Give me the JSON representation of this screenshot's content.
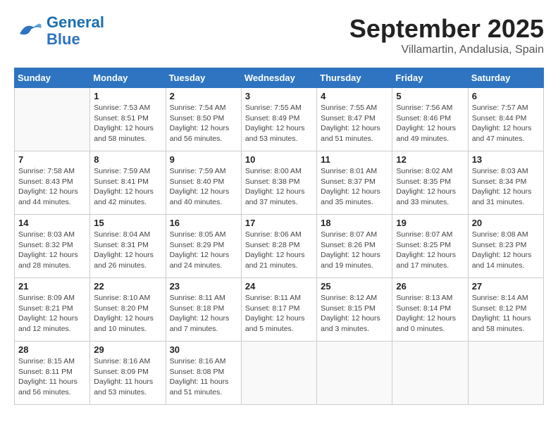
{
  "header": {
    "logo_line1": "General",
    "logo_line2": "Blue",
    "month": "September 2025",
    "location": "Villamartin, Andalusia, Spain"
  },
  "weekdays": [
    "Sunday",
    "Monday",
    "Tuesday",
    "Wednesday",
    "Thursday",
    "Friday",
    "Saturday"
  ],
  "weeks": [
    [
      {
        "day": "",
        "info": ""
      },
      {
        "day": "1",
        "info": "Sunrise: 7:53 AM\nSunset: 8:51 PM\nDaylight: 12 hours\nand 58 minutes."
      },
      {
        "day": "2",
        "info": "Sunrise: 7:54 AM\nSunset: 8:50 PM\nDaylight: 12 hours\nand 56 minutes."
      },
      {
        "day": "3",
        "info": "Sunrise: 7:55 AM\nSunset: 8:49 PM\nDaylight: 12 hours\nand 53 minutes."
      },
      {
        "day": "4",
        "info": "Sunrise: 7:55 AM\nSunset: 8:47 PM\nDaylight: 12 hours\nand 51 minutes."
      },
      {
        "day": "5",
        "info": "Sunrise: 7:56 AM\nSunset: 8:46 PM\nDaylight: 12 hours\nand 49 minutes."
      },
      {
        "day": "6",
        "info": "Sunrise: 7:57 AM\nSunset: 8:44 PM\nDaylight: 12 hours\nand 47 minutes."
      }
    ],
    [
      {
        "day": "7",
        "info": "Sunrise: 7:58 AM\nSunset: 8:43 PM\nDaylight: 12 hours\nand 44 minutes."
      },
      {
        "day": "8",
        "info": "Sunrise: 7:59 AM\nSunset: 8:41 PM\nDaylight: 12 hours\nand 42 minutes."
      },
      {
        "day": "9",
        "info": "Sunrise: 7:59 AM\nSunset: 8:40 PM\nDaylight: 12 hours\nand 40 minutes."
      },
      {
        "day": "10",
        "info": "Sunrise: 8:00 AM\nSunset: 8:38 PM\nDaylight: 12 hours\nand 37 minutes."
      },
      {
        "day": "11",
        "info": "Sunrise: 8:01 AM\nSunset: 8:37 PM\nDaylight: 12 hours\nand 35 minutes."
      },
      {
        "day": "12",
        "info": "Sunrise: 8:02 AM\nSunset: 8:35 PM\nDaylight: 12 hours\nand 33 minutes."
      },
      {
        "day": "13",
        "info": "Sunrise: 8:03 AM\nSunset: 8:34 PM\nDaylight: 12 hours\nand 31 minutes."
      }
    ],
    [
      {
        "day": "14",
        "info": "Sunrise: 8:03 AM\nSunset: 8:32 PM\nDaylight: 12 hours\nand 28 minutes."
      },
      {
        "day": "15",
        "info": "Sunrise: 8:04 AM\nSunset: 8:31 PM\nDaylight: 12 hours\nand 26 minutes."
      },
      {
        "day": "16",
        "info": "Sunrise: 8:05 AM\nSunset: 8:29 PM\nDaylight: 12 hours\nand 24 minutes."
      },
      {
        "day": "17",
        "info": "Sunrise: 8:06 AM\nSunset: 8:28 PM\nDaylight: 12 hours\nand 21 minutes."
      },
      {
        "day": "18",
        "info": "Sunrise: 8:07 AM\nSunset: 8:26 PM\nDaylight: 12 hours\nand 19 minutes."
      },
      {
        "day": "19",
        "info": "Sunrise: 8:07 AM\nSunset: 8:25 PM\nDaylight: 12 hours\nand 17 minutes."
      },
      {
        "day": "20",
        "info": "Sunrise: 8:08 AM\nSunset: 8:23 PM\nDaylight: 12 hours\nand 14 minutes."
      }
    ],
    [
      {
        "day": "21",
        "info": "Sunrise: 8:09 AM\nSunset: 8:21 PM\nDaylight: 12 hours\nand 12 minutes."
      },
      {
        "day": "22",
        "info": "Sunrise: 8:10 AM\nSunset: 8:20 PM\nDaylight: 12 hours\nand 10 minutes."
      },
      {
        "day": "23",
        "info": "Sunrise: 8:11 AM\nSunset: 8:18 PM\nDaylight: 12 hours\nand 7 minutes."
      },
      {
        "day": "24",
        "info": "Sunrise: 8:11 AM\nSunset: 8:17 PM\nDaylight: 12 hours\nand 5 minutes."
      },
      {
        "day": "25",
        "info": "Sunrise: 8:12 AM\nSunset: 8:15 PM\nDaylight: 12 hours\nand 3 minutes."
      },
      {
        "day": "26",
        "info": "Sunrise: 8:13 AM\nSunset: 8:14 PM\nDaylight: 12 hours\nand 0 minutes."
      },
      {
        "day": "27",
        "info": "Sunrise: 8:14 AM\nSunset: 8:12 PM\nDaylight: 11 hours\nand 58 minutes."
      }
    ],
    [
      {
        "day": "28",
        "info": "Sunrise: 8:15 AM\nSunset: 8:11 PM\nDaylight: 11 hours\nand 56 minutes."
      },
      {
        "day": "29",
        "info": "Sunrise: 8:16 AM\nSunset: 8:09 PM\nDaylight: 11 hours\nand 53 minutes."
      },
      {
        "day": "30",
        "info": "Sunrise: 8:16 AM\nSunset: 8:08 PM\nDaylight: 11 hours\nand 51 minutes."
      },
      {
        "day": "",
        "info": ""
      },
      {
        "day": "",
        "info": ""
      },
      {
        "day": "",
        "info": ""
      },
      {
        "day": "",
        "info": ""
      }
    ]
  ]
}
